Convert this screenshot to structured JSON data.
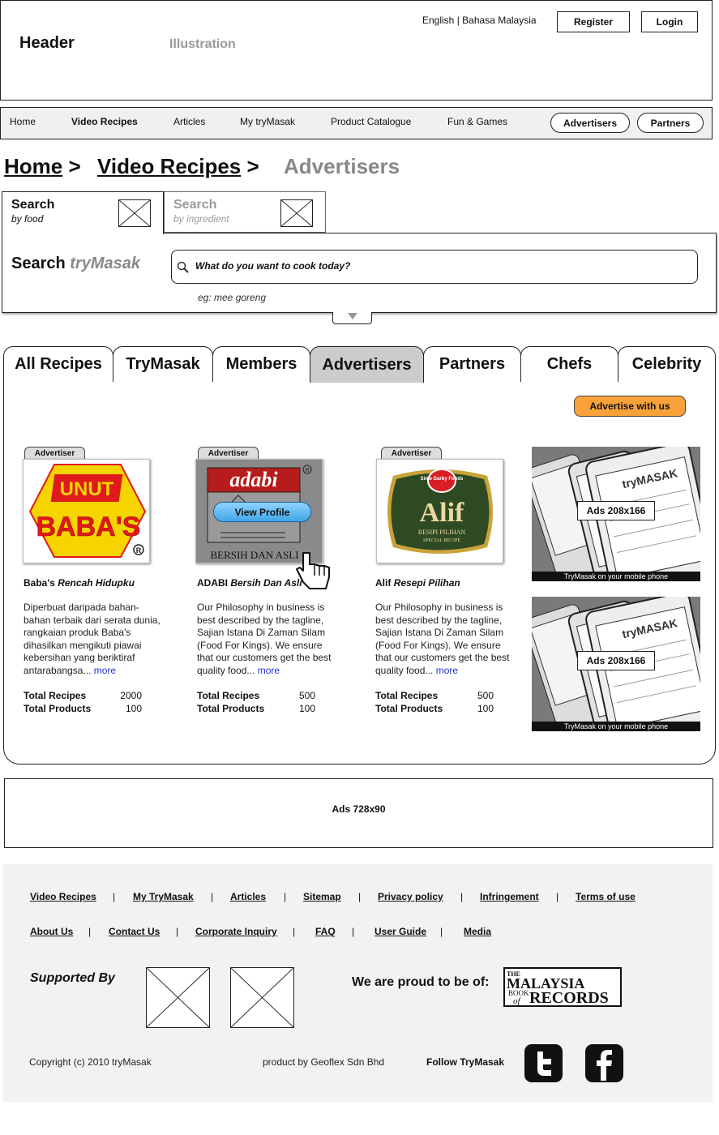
{
  "header": {
    "title": "Header",
    "illustration": "Illustration",
    "lang_english": "English",
    "lang_sep": "|",
    "lang_malay": "Bahasa Malaysia",
    "register": "Register",
    "login": "Login"
  },
  "nav": {
    "items": [
      "Home",
      "Video Recipes",
      "Articles",
      "My tryMasak",
      "Product Catalogue",
      "Fun & Games"
    ],
    "active": "Video Recipes",
    "advertisers": "Advertisers",
    "partners": "Partners"
  },
  "breadcrumb": {
    "home": "Home",
    "video": "Video Recipes",
    "current": "Advertisers",
    "sep": ">"
  },
  "search": {
    "tab_food_title": "Search",
    "tab_food_sub": "by food",
    "tab_ingr_title": "Search",
    "tab_ingr_sub": "by ingredient",
    "label_prefix": "Search",
    "label_brand": "tryMasak",
    "placeholder": "What do you want to cook today?",
    "example": "eg: mee goreng"
  },
  "tabs": [
    "All Recipes",
    "TryMasak",
    "Members",
    "Advertisers",
    "Partners",
    "Chefs",
    "Celebrity"
  ],
  "advertise_button": "Advertise with us",
  "advertisers": [
    {
      "tag": "Advertiser",
      "name": "Baba's",
      "tagline": "Rencah Hidupku",
      "logo_text": "BABA'S",
      "logo_top": "UNUT",
      "desc": "Diperbuat daripada bahan-bahan terbaik dari serata dunia, rangkaian produk Baba's dihasilkan mengikuti piawai kebersihan yang beriktiraf antarabangsa...",
      "more": "more",
      "recipes_label": "Total Recipes",
      "recipes": "2000",
      "products_label": "Total Products",
      "products": "100"
    },
    {
      "tag": "Advertiser",
      "name": "ADABI",
      "tagline": "Bersih Dan Asli",
      "logo_text": "adabi",
      "logo_sub": "BERSIH DAN ASLI",
      "view_profile": "View Profile",
      "desc": "Our Philosophy in business is best described by the tagline, Sajian Istana Di Zaman Silam (Food For Kings). We ensure that our customers get the best quality food...",
      "more": "more",
      "recipes_label": "Total Recipes",
      "recipes": "500",
      "products_label": "Total Products",
      "products": "100"
    },
    {
      "tag": "Advertiser",
      "name": "Alif",
      "tagline": "Resepi Pilihan",
      "logo_text": "Alif",
      "logo_sub": "RESIPI PILIHAN",
      "logo_sub2": "SPECIAL RECIPE",
      "logo_badge": "Sime Darby Foods",
      "desc": "Our Philosophy in business is best described by the tagline, Sajian Istana Di Zaman Silam (Food For Kings). We ensure that our customers get the best quality food...",
      "more": "more",
      "recipes_label": "Total Recipes",
      "recipes": "500",
      "products_label": "Total Products",
      "products": "100"
    }
  ],
  "side_ads": [
    {
      "label": "Ads 208x166",
      "caption": "TryMasak on your mobile phone",
      "brand": "tryMASAK"
    },
    {
      "label": "Ads 208x166",
      "caption": "TryMasak on your mobile phone",
      "brand": "tryMASAK"
    }
  ],
  "banner_ad": "Ads 728x90",
  "footer": {
    "row1": [
      "Video Recipes",
      "My TryMasak",
      "Articles",
      "Sitemap",
      "Privacy policy",
      "Infringement",
      "Terms of use"
    ],
    "row2": [
      "About Us",
      "Contact Us",
      "Corporate Inquiry",
      "FAQ",
      "User Guide",
      "Media"
    ],
    "sep": "|",
    "supported_by": "Supported By",
    "proud": "We are proud to be of:",
    "records_line1": "THE",
    "records_line2": "MALAYSIA",
    "records_line3": "BOOK",
    "records_line4": "of",
    "records_line5": "RECORDS",
    "copyright": "Copyright (c) 2010 tryMasak",
    "product_by": "product by Geoflex Sdn Bhd",
    "follow": "Follow TryMasak"
  },
  "colors": {
    "accent_orange": "#f9a23a",
    "view_profile_blue": "#5ab8f0",
    "link_blue": "#2233cc",
    "babas_red": "#e01a1a",
    "babas_yellow": "#f5d400",
    "alif_green": "#2e4a22"
  }
}
